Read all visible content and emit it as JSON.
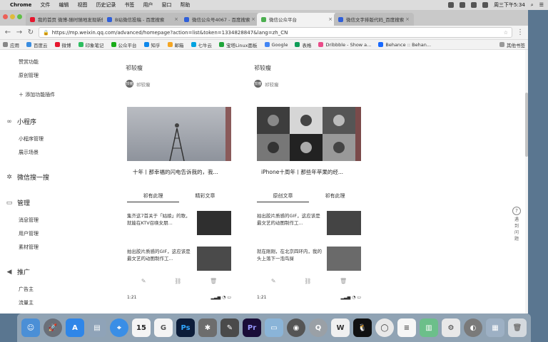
{
  "menubar": {
    "app": "Chrome",
    "items": [
      "文件",
      "编辑",
      "视图",
      "历史记录",
      "书签",
      "用户",
      "窗口",
      "帮助"
    ],
    "clock": "周三下午5:34"
  },
  "tabs": [
    {
      "label": "我的首页 微博-随时随地发现新鲜事"
    },
    {
      "label": "B站微信投稿 - 百度搜索"
    },
    {
      "label": "微信公众号4067 - 百度搜索"
    },
    {
      "label": "微信公众平台"
    },
    {
      "label": "微信文字排版代码_百度搜索"
    }
  ],
  "address": {
    "url": "https://mp.weixin.qq.com/advanced/homepage?action=list&token=1334828847&lang=zh_CN"
  },
  "bookmarks": [
    "应用",
    "百度云",
    "微博",
    "印象笔记",
    "公众平台",
    "知乎",
    "邮箱",
    "七牛云",
    "宝塔Linux面板",
    "Google",
    "表格",
    "Dribbble - Show a...",
    "Behance :: Behan..."
  ],
  "bookmarks_other": "其他书签",
  "sidebar": {
    "top_links": [
      "赞赏功能",
      "原创管理"
    ],
    "add_plugin": "添加功能插件",
    "mini_program": {
      "title": "小程序",
      "links": [
        "小程序管理",
        "展示场景"
      ]
    },
    "search": {
      "title": "微信搜一搜"
    },
    "manage": {
      "title": "管理",
      "links": [
        "消息管理",
        "用户管理",
        "素材管理"
      ]
    },
    "promo": {
      "title": "推广",
      "links": [
        "广告主",
        "流量主"
      ]
    }
  },
  "cards": [
    {
      "title": "祁较瘦",
      "author": "祁较瘦",
      "avatar": "较瘦",
      "caption": "十年丨那幸福的闪电告诉我的，我...",
      "tabs": [
        "祁有此理",
        "精彩文章"
      ],
      "active_tab": 0,
      "items": [
        "集齐这7首关于「姑娘」的歌，就能在KTV召唤女朋...",
        "拍出胶片质感的GIF，这应该是最文艺的动图制作工..."
      ],
      "time": "1:21"
    },
    {
      "title": "祁较瘦",
      "author": "祁较瘦",
      "avatar": "较瘦",
      "caption": "iPhone十周年丨那些年苹果的经...",
      "tabs": [
        "原创文章",
        "祁有此理"
      ],
      "active_tab": 0,
      "items": [
        "拍出胶片质感的GIF，这应该是最文艺的动图制作工...",
        "就在刚刚，在北京四环内，我的头上落下一泡鸟屎"
      ],
      "time": "1:21"
    }
  ],
  "float_help": [
    "遇",
    "到",
    "问",
    "题"
  ],
  "dock": [
    "Finder",
    "Launchpad",
    "App Store",
    "Preview",
    "Safari",
    "Calendar",
    "Git",
    "Photoshop",
    "Utility",
    "Script",
    "Premiere",
    "Keynote",
    "Camera",
    "QuickTime",
    "Word",
    "QQ",
    "WeChat",
    "Notes",
    "Books",
    "Settings",
    "Network",
    "Screen Time",
    "Trash"
  ],
  "dock_calendar_day": "15"
}
